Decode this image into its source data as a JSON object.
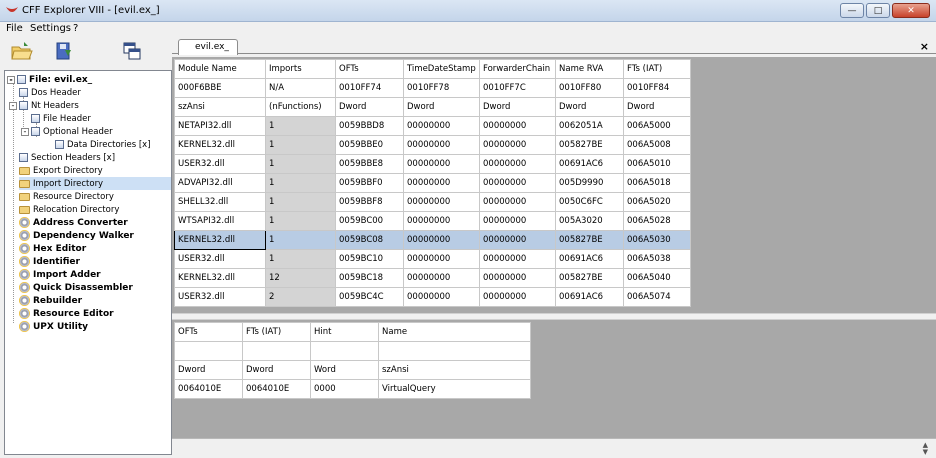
{
  "window": {
    "title": "CFF Explorer VIII - [evil.ex_]"
  },
  "menu": [
    "File",
    "Settings",
    "?"
  ],
  "tab": {
    "label": "evil.ex_",
    "close_glyph": "×"
  },
  "tree": {
    "root": "File: evil.ex_",
    "items": [
      "Dos Header",
      "Nt Headers",
      "File Header",
      "Optional Header",
      "Data Directories [x]",
      "Section Headers [x]",
      "Export Directory",
      "Import Directory",
      "Resource Directory",
      "Relocation Directory"
    ],
    "tools": [
      "Address Converter",
      "Dependency Walker",
      "Hex Editor",
      "Identifier",
      "Import Adder",
      "Quick Disassembler",
      "Rebuilder",
      "Resource Editor",
      "UPX Utility"
    ]
  },
  "imports_table": {
    "columns": [
      "Module Name",
      "Imports",
      "OFTs",
      "TimeDateStamp",
      "ForwarderChain",
      "Name RVA",
      "FTs (IAT)"
    ],
    "offsets": [
      "000F6BBE",
      "N/A",
      "0010FF74",
      "0010FF78",
      "0010FF7C",
      "0010FF80",
      "0010FF84"
    ],
    "types": [
      "szAnsi",
      "(nFunctions)",
      "Dword",
      "Dword",
      "Dword",
      "Dword",
      "Dword"
    ],
    "rows": [
      [
        "NETAPI32.dll",
        "1",
        "0059BBD8",
        "00000000",
        "00000000",
        "0062051A",
        "006A5000"
      ],
      [
        "KERNEL32.dll",
        "1",
        "0059BBE0",
        "00000000",
        "00000000",
        "005827BE",
        "006A5008"
      ],
      [
        "USER32.dll",
        "1",
        "0059BBE8",
        "00000000",
        "00000000",
        "00691AC6",
        "006A5010"
      ],
      [
        "ADVAPI32.dll",
        "1",
        "0059BBF0",
        "00000000",
        "00000000",
        "005D9990",
        "006A5018"
      ],
      [
        "SHELL32.dll",
        "1",
        "0059BBF8",
        "00000000",
        "00000000",
        "0050C6FC",
        "006A5020"
      ],
      [
        "WTSAPI32.dll",
        "1",
        "0059BC00",
        "00000000",
        "00000000",
        "005A3020",
        "006A5028"
      ],
      [
        "KERNEL32.dll",
        "1",
        "0059BC08",
        "00000000",
        "00000000",
        "005827BE",
        "006A5030"
      ],
      [
        "USER32.dll",
        "1",
        "0059BC10",
        "00000000",
        "00000000",
        "00691AC6",
        "006A5038"
      ],
      [
        "KERNEL32.dll",
        "12",
        "0059BC18",
        "00000000",
        "00000000",
        "005827BE",
        "006A5040"
      ],
      [
        "USER32.dll",
        "2",
        "0059BC4C",
        "00000000",
        "00000000",
        "00691AC6",
        "006A5074"
      ]
    ]
  },
  "functions_table": {
    "columns": [
      "OFTs",
      "FTs (IAT)",
      "Hint",
      "Name"
    ],
    "offsets": [
      "",
      "",
      "",
      ""
    ],
    "types": [
      "Dword",
      "Dword",
      "Word",
      "szAnsi"
    ],
    "rows": [
      [
        "0064010E",
        "0064010E",
        "0000",
        "VirtualQuery"
      ]
    ]
  },
  "colors": {
    "selection": "#b8cce4",
    "panel_bg": "#a8a8a8",
    "tree_selection": "#cde0f5"
  }
}
